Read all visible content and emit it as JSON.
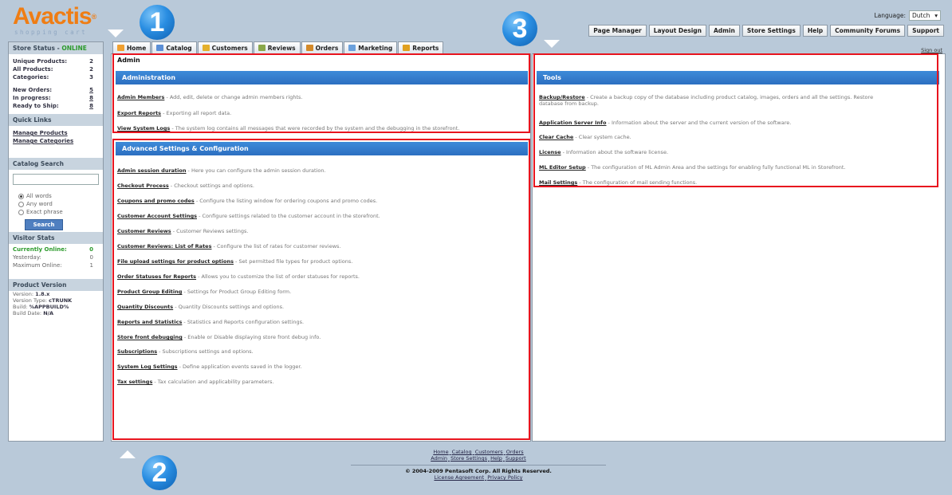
{
  "logo": {
    "main": "Avactis",
    "tm": "®",
    "sub": "shopping cart"
  },
  "callouts": {
    "one": "1",
    "two": "2",
    "three": "3"
  },
  "language": {
    "label": "Language:",
    "value": "Dutch"
  },
  "top_menu": [
    "Page Manager",
    "Layout Design",
    "Admin",
    "Store Settings",
    "Help",
    "Community Forums",
    "Support"
  ],
  "signout": "Sign out",
  "tabs": [
    {
      "label": "Home",
      "icon": "home-icon",
      "color": "#f0a030"
    },
    {
      "label": "Catalog",
      "icon": "catalog-icon",
      "color": "#5b8fd6"
    },
    {
      "label": "Customers",
      "icon": "customers-icon",
      "color": "#e4b02c"
    },
    {
      "label": "Reviews",
      "icon": "reviews-icon",
      "color": "#8aa84a"
    },
    {
      "label": "Orders",
      "icon": "orders-icon",
      "color": "#d48a2a"
    },
    {
      "label": "Marketing",
      "icon": "marketing-icon",
      "color": "#6aa0dc"
    },
    {
      "label": "Reports",
      "icon": "reports-icon",
      "color": "#e0a020"
    }
  ],
  "sidebar": {
    "store_status": {
      "title": "Store Status - ",
      "status": "ONLINE"
    },
    "stats": [
      {
        "label": "Unique Products:",
        "value": "2"
      },
      {
        "label": "All Products:",
        "value": "2"
      },
      {
        "label": "Categories:",
        "value": "3"
      }
    ],
    "orders": [
      {
        "label": "New Orders:",
        "value": "5"
      },
      {
        "label": "In progress:",
        "value": "8"
      },
      {
        "label": "Ready to Ship:",
        "value": "8"
      }
    ],
    "quick_links": {
      "title": "Quick Links",
      "items": [
        "Manage Products",
        "Manage Categories"
      ]
    },
    "catalog_search": {
      "title": "Catalog Search",
      "options": [
        "All words",
        "Any word",
        "Exact phrase"
      ],
      "button": "Search"
    },
    "visitor_stats": {
      "title": "Visitor Stats",
      "rows": [
        {
          "label": "Currently Online:",
          "value": "0"
        },
        {
          "label": "Yesterday:",
          "value": "0"
        },
        {
          "label": "Maximum Online:",
          "value": "1"
        }
      ]
    },
    "product_version": {
      "title": "Product Version",
      "lines": [
        {
          "label": "Version:",
          "value": "1.8.x"
        },
        {
          "label": "Version Type:",
          "value": "cTRUNK"
        },
        {
          "label": "Build:",
          "value": "%APPBUILD%"
        },
        {
          "label": "Build Date:",
          "value": "N/A"
        }
      ]
    }
  },
  "main": {
    "admin_title": "Admin",
    "administration": {
      "title": "Administration",
      "items": [
        {
          "link": "Admin Members",
          "desc": " - Add, edit, delete or change admin members rights."
        },
        {
          "link": "Export Reports",
          "desc": " - Exporting all report data."
        },
        {
          "link": "View System Logs",
          "desc": " - The system log contains all messages that were recorded by the system and the debugging in the storefront."
        }
      ]
    },
    "advanced": {
      "title": "Advanced Settings & Configuration",
      "items": [
        {
          "link": "Admin session duration",
          "desc": " - Here you can configure the admin session duration."
        },
        {
          "link": "Checkout Process",
          "desc": " - Checkout settings and options."
        },
        {
          "link": "Coupons and promo codes",
          "desc": " - Configure the listing window for ordering coupons and promo codes."
        },
        {
          "link": "Customer Account Settings",
          "desc": " - Configure settings related to the customer account in the storefront."
        },
        {
          "link": "Customer Reviews",
          "desc": " - Customer Reviews settings."
        },
        {
          "link": "Customer Reviews: List of Rates",
          "desc": " - Configure the list of rates for customer reviews."
        },
        {
          "link": "File upload settings for product options",
          "desc": " - Set permitted file types for product options."
        },
        {
          "link": "Order Statuses for Reports",
          "desc": " - Allows you to customize the list of order statuses for reports."
        },
        {
          "link": "Product Group Editing",
          "desc": " - Settings for Product Group Editing form."
        },
        {
          "link": "Quantity Discounts",
          "desc": " - Quantity Discounts settings and options."
        },
        {
          "link": "Reports and Statistics",
          "desc": " - Statistics and Reports configuration settings."
        },
        {
          "link": "Store front debugging",
          "desc": " - Enable or Disable displaying store front debug info."
        },
        {
          "link": "Subscriptions",
          "desc": " - Subscriptions settings and options."
        },
        {
          "link": "System Log Settings",
          "desc": " - Define application events saved in the logger."
        },
        {
          "link": "Tax settings",
          "desc": " - Tax calculation and applicability parameters."
        }
      ]
    },
    "tools": {
      "title": "Tools",
      "items": [
        {
          "link": "Backup/Restore",
          "desc": " - Create a backup copy of the database including product catalog, images, orders and all the settings. Restore database from backup."
        },
        {
          "link": "Application Server Info",
          "desc": " - Information about the server and the current version of the software."
        },
        {
          "link": "Clear Cache",
          "desc": " - Clear system cache."
        },
        {
          "link": "License",
          "desc": " - Information about the software license."
        },
        {
          "link": "ML Editor Setup",
          "desc": " - The configuration of ML Admin Area and the settings for enabling fully functional ML in Storefront."
        },
        {
          "link": "Mail Settings",
          "desc": " - The configuration of mail sending functions."
        }
      ]
    }
  },
  "footer": {
    "links_row1": [
      "Home",
      "Catalog",
      "Customers",
      "Orders"
    ],
    "links_row2": [
      "Admin",
      "Store Settings",
      "Help",
      "Support"
    ],
    "copyright": "© 2004-2009 Pentasoft Corp. All Rights Reserved.",
    "links_row3": [
      "License Agreement",
      "Privacy Policy"
    ]
  }
}
